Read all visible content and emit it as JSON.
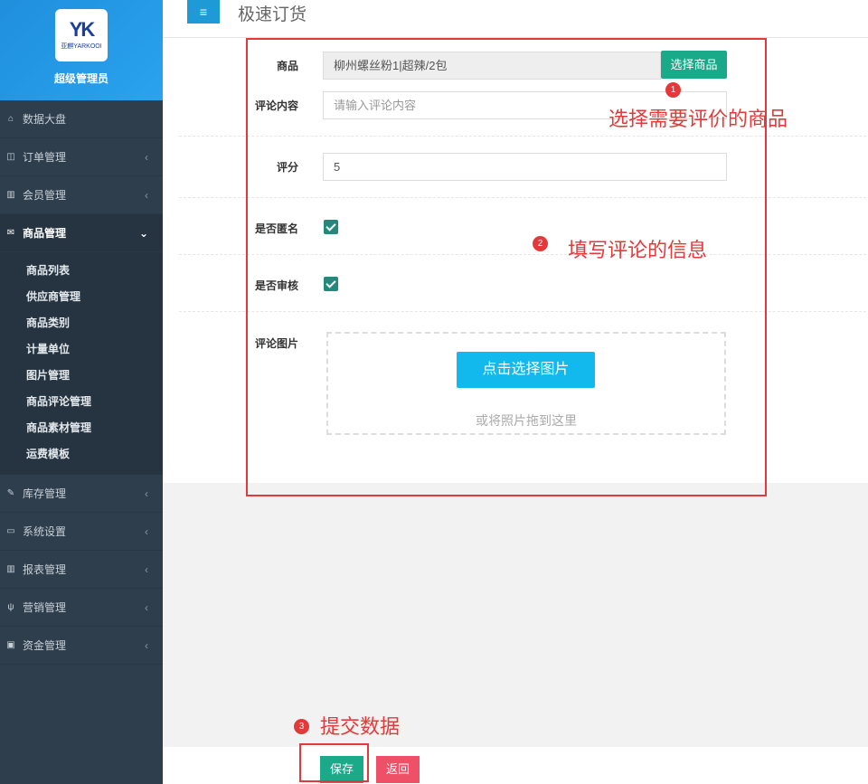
{
  "brand": {
    "logo_mark": "YK",
    "logo_text": "亚麒YARKOOI",
    "user_role": "超级管理员"
  },
  "sidebar": {
    "items": [
      {
        "label": "数据大盘",
        "icon": "home-icon",
        "glyph": "⌂"
      },
      {
        "label": "订单管理",
        "icon": "columns-icon",
        "glyph": "◫",
        "arrow": "‹"
      },
      {
        "label": "会员管理",
        "icon": "bar-chart-icon",
        "glyph": "▥",
        "arrow": "‹"
      },
      {
        "label": "商品管理",
        "icon": "envelope-icon",
        "glyph": "✉",
        "arrow": "⌄"
      },
      {
        "label": "库存管理",
        "icon": "edit-icon",
        "glyph": "✎",
        "arrow": "‹"
      },
      {
        "label": "系统设置",
        "icon": "desktop-icon",
        "glyph": "▭",
        "arrow": "‹"
      },
      {
        "label": "报表管理",
        "icon": "bar-chart-icon",
        "glyph": "▥",
        "arrow": "‹"
      },
      {
        "label": "营销管理",
        "icon": "cutlery-icon",
        "glyph": "ψ",
        "arrow": "‹"
      },
      {
        "label": "资金管理",
        "icon": "money-icon",
        "glyph": "▣",
        "arrow": "‹"
      }
    ],
    "submenu": [
      "商品列表",
      "供应商管理",
      "商品类别",
      "计量单位",
      "图片管理",
      "商品评论管理",
      "商品素材管理",
      "运费模板"
    ]
  },
  "header": {
    "menu_glyph": "≡",
    "title": "极速订货"
  },
  "form": {
    "product_label": "商品",
    "product_value": "柳州螺丝粉1|超辣/2包",
    "select_product_button": "选择商品",
    "comment_label": "评论内容",
    "comment_placeholder": "请输入评论内容",
    "score_label": "评分",
    "score_value": "5",
    "anonymous_label": "是否匿名",
    "anonymous_checked": true,
    "review_label": "是否审核",
    "review_checked": true,
    "image_label": "评论图片",
    "pick_image_button": "点击选择图片",
    "drop_hint": "或将照片拖到这里"
  },
  "annotations": {
    "step1_num": "1",
    "step1_text": "选择需要评价的商品",
    "step2_num": "2",
    "step2_text": "填写评论的信息",
    "step3_num": "3",
    "step3_text": "提交数据"
  },
  "footer": {
    "save_button": "保存",
    "back_button": "返回"
  },
  "colors": {
    "sidebar_bg": "#2f3e4c",
    "brand_blue": "#1f8fdc",
    "green": "#1aaa8a",
    "cyan": "#12b9ec",
    "red": "#e23a3a",
    "pink": "#ee5167"
  }
}
